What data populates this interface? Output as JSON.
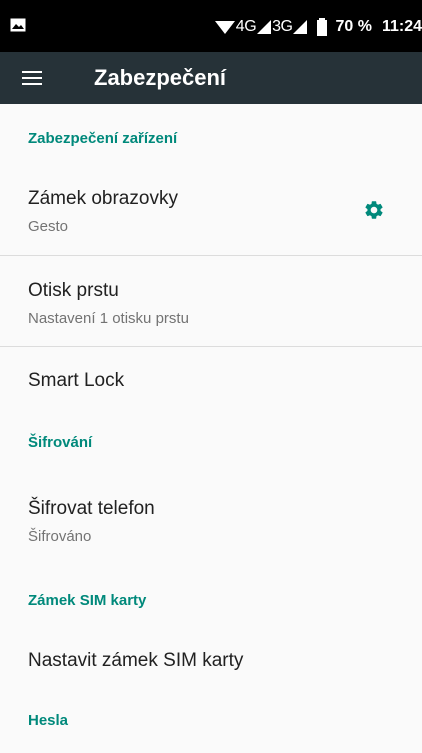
{
  "status_bar": {
    "network_4g": "4G",
    "network_3g": "3G",
    "battery_percent": "70 %",
    "time": "11:24"
  },
  "toolbar": {
    "title": "Zabezpečení"
  },
  "sections": {
    "device_security": {
      "header": "Zabezpečení zařízení"
    },
    "screen_lock": {
      "title": "Zámek obrazovky",
      "summary": "Gesto"
    },
    "fingerprint": {
      "title": "Otisk prstu",
      "summary": "Nastavení 1 otisku prstu"
    },
    "smart_lock": {
      "title": "Smart Lock"
    },
    "encryption": {
      "header": "Šifrování"
    },
    "encrypt_phone": {
      "title": "Šifrovat telefon",
      "summary": "Šifrováno"
    },
    "sim_lock": {
      "header": "Zámek SIM karty"
    },
    "set_sim_lock": {
      "title": "Nastavit zámek SIM karty"
    },
    "passwords": {
      "header": "Hesla"
    }
  },
  "colors": {
    "accent": "#00897b",
    "toolbar": "#263238",
    "status_bar": "#000000"
  }
}
